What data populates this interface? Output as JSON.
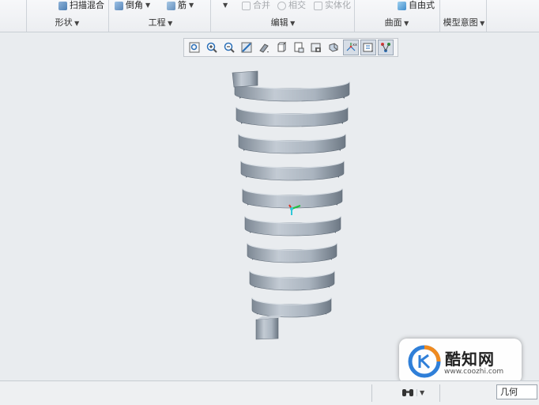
{
  "ribbon": {
    "items": {
      "sweep_blend": "扫描混合",
      "chamfer": "倒角",
      "rib": "筋",
      "merge": "合并",
      "intersect": "相交",
      "solidify": "实体化",
      "freestyle": "自由式"
    },
    "groups": {
      "shape": "形状",
      "engineering": "工程",
      "editing": "编辑",
      "surfaces": "曲面",
      "model_intent": "模型意图"
    }
  },
  "watermark": {
    "title": "酷知网",
    "url": "www.coozhi.com"
  },
  "statusbar": {
    "filter_value": "几何"
  },
  "colors": {
    "spring_light": "#b9c2cc",
    "spring_dark": "#6f7a86",
    "accent_green": "#20c040",
    "accent_red": "#e03020",
    "accent_cyan": "#30c8d8"
  }
}
